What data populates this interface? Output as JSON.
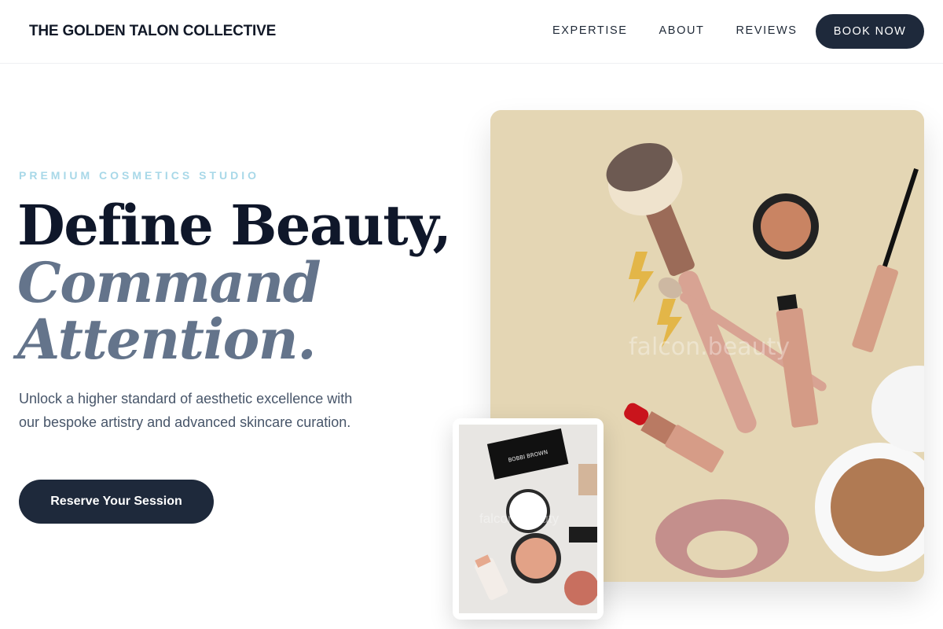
{
  "nav": {
    "brand": "THE GOLDEN TALON COLLECTIVE",
    "links": [
      "EXPERTISE",
      "ABOUT",
      "REVIEWS"
    ],
    "book_label": "BOOK NOW"
  },
  "hero": {
    "eyebrow": "PREMIUM COSMETICS STUDIO",
    "headline_line1": "Define Beauty,",
    "headline_line2": "Command",
    "headline_line3": "Attention.",
    "lead": "Unlock a higher standard of aesthetic excellence with our bespoke artistry and advanced skincare curation.",
    "cta_label": "Reserve Your Session"
  },
  "images": {
    "main_watermark": "falcon.beauty",
    "thumb_watermark": "falcon.beauty",
    "thumb_palette_label": "BOBBI BROWN"
  },
  "colors": {
    "primary": "#1e293b",
    "eyebrow": "#a8d8e8",
    "accent_italic": "#64748b",
    "photo_bg": "#e4d6b4"
  }
}
